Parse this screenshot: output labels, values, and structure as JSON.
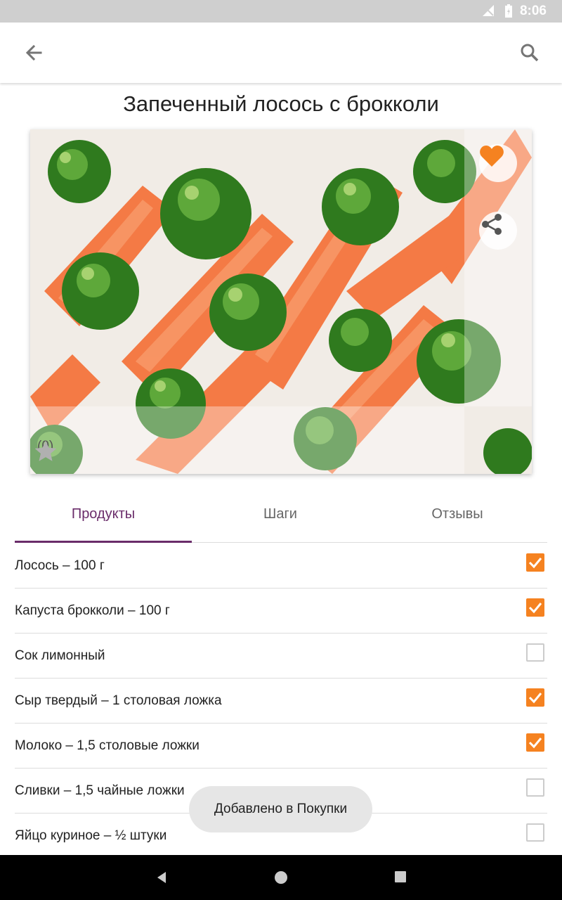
{
  "status_bar": {
    "time": "8:06"
  },
  "recipe": {
    "title": "Запеченный лосось с брокколи",
    "rating_count": "(0)"
  },
  "tabs": [
    {
      "label": "Продукты",
      "active": true
    },
    {
      "label": "Шаги",
      "active": false
    },
    {
      "label": "Отзывы",
      "active": false
    }
  ],
  "ingredients": [
    {
      "label": "Лосось – 100 г",
      "checked": true
    },
    {
      "label": "Капуста брокколи – 100 г",
      "checked": true
    },
    {
      "label": "Сок лимонный",
      "checked": false
    },
    {
      "label": "Сыр твердый – 1 столовая ложка",
      "checked": true
    },
    {
      "label": "Молоко – 1,5 столовые ложки",
      "checked": true
    },
    {
      "label": "Сливки – 1,5 чайные ложки",
      "checked": false
    },
    {
      "label": "Яйцо куриное – ½ штуки",
      "checked": false
    }
  ],
  "toast": {
    "text": "Добавлено в Покупки"
  },
  "colors": {
    "accent": "#f58220",
    "tab_active": "#6a2c6a",
    "status_bar": "#cfcfcf"
  },
  "icons": [
    "back-arrow-icon",
    "search-icon",
    "heart-icon",
    "share-icon",
    "star-icon",
    "check-icon",
    "nav-back-icon",
    "nav-home-icon",
    "nav-recents-icon"
  ]
}
